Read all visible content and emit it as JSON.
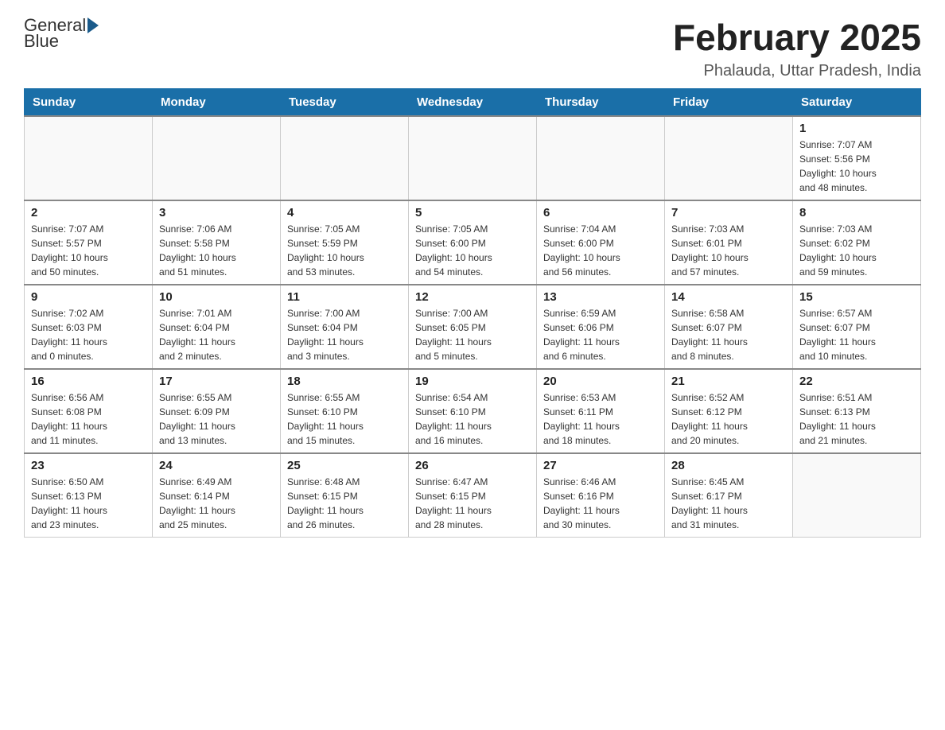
{
  "header": {
    "logo_general": "General",
    "logo_blue": "Blue",
    "month_title": "February 2025",
    "location": "Phalauda, Uttar Pradesh, India"
  },
  "days_of_week": [
    "Sunday",
    "Monday",
    "Tuesday",
    "Wednesday",
    "Thursday",
    "Friday",
    "Saturday"
  ],
  "weeks": [
    [
      {
        "day": "",
        "info": ""
      },
      {
        "day": "",
        "info": ""
      },
      {
        "day": "",
        "info": ""
      },
      {
        "day": "",
        "info": ""
      },
      {
        "day": "",
        "info": ""
      },
      {
        "day": "",
        "info": ""
      },
      {
        "day": "1",
        "info": "Sunrise: 7:07 AM\nSunset: 5:56 PM\nDaylight: 10 hours\nand 48 minutes."
      }
    ],
    [
      {
        "day": "2",
        "info": "Sunrise: 7:07 AM\nSunset: 5:57 PM\nDaylight: 10 hours\nand 50 minutes."
      },
      {
        "day": "3",
        "info": "Sunrise: 7:06 AM\nSunset: 5:58 PM\nDaylight: 10 hours\nand 51 minutes."
      },
      {
        "day": "4",
        "info": "Sunrise: 7:05 AM\nSunset: 5:59 PM\nDaylight: 10 hours\nand 53 minutes."
      },
      {
        "day": "5",
        "info": "Sunrise: 7:05 AM\nSunset: 6:00 PM\nDaylight: 10 hours\nand 54 minutes."
      },
      {
        "day": "6",
        "info": "Sunrise: 7:04 AM\nSunset: 6:00 PM\nDaylight: 10 hours\nand 56 minutes."
      },
      {
        "day": "7",
        "info": "Sunrise: 7:03 AM\nSunset: 6:01 PM\nDaylight: 10 hours\nand 57 minutes."
      },
      {
        "day": "8",
        "info": "Sunrise: 7:03 AM\nSunset: 6:02 PM\nDaylight: 10 hours\nand 59 minutes."
      }
    ],
    [
      {
        "day": "9",
        "info": "Sunrise: 7:02 AM\nSunset: 6:03 PM\nDaylight: 11 hours\nand 0 minutes."
      },
      {
        "day": "10",
        "info": "Sunrise: 7:01 AM\nSunset: 6:04 PM\nDaylight: 11 hours\nand 2 minutes."
      },
      {
        "day": "11",
        "info": "Sunrise: 7:00 AM\nSunset: 6:04 PM\nDaylight: 11 hours\nand 3 minutes."
      },
      {
        "day": "12",
        "info": "Sunrise: 7:00 AM\nSunset: 6:05 PM\nDaylight: 11 hours\nand 5 minutes."
      },
      {
        "day": "13",
        "info": "Sunrise: 6:59 AM\nSunset: 6:06 PM\nDaylight: 11 hours\nand 6 minutes."
      },
      {
        "day": "14",
        "info": "Sunrise: 6:58 AM\nSunset: 6:07 PM\nDaylight: 11 hours\nand 8 minutes."
      },
      {
        "day": "15",
        "info": "Sunrise: 6:57 AM\nSunset: 6:07 PM\nDaylight: 11 hours\nand 10 minutes."
      }
    ],
    [
      {
        "day": "16",
        "info": "Sunrise: 6:56 AM\nSunset: 6:08 PM\nDaylight: 11 hours\nand 11 minutes."
      },
      {
        "day": "17",
        "info": "Sunrise: 6:55 AM\nSunset: 6:09 PM\nDaylight: 11 hours\nand 13 minutes."
      },
      {
        "day": "18",
        "info": "Sunrise: 6:55 AM\nSunset: 6:10 PM\nDaylight: 11 hours\nand 15 minutes."
      },
      {
        "day": "19",
        "info": "Sunrise: 6:54 AM\nSunset: 6:10 PM\nDaylight: 11 hours\nand 16 minutes."
      },
      {
        "day": "20",
        "info": "Sunrise: 6:53 AM\nSunset: 6:11 PM\nDaylight: 11 hours\nand 18 minutes."
      },
      {
        "day": "21",
        "info": "Sunrise: 6:52 AM\nSunset: 6:12 PM\nDaylight: 11 hours\nand 20 minutes."
      },
      {
        "day": "22",
        "info": "Sunrise: 6:51 AM\nSunset: 6:13 PM\nDaylight: 11 hours\nand 21 minutes."
      }
    ],
    [
      {
        "day": "23",
        "info": "Sunrise: 6:50 AM\nSunset: 6:13 PM\nDaylight: 11 hours\nand 23 minutes."
      },
      {
        "day": "24",
        "info": "Sunrise: 6:49 AM\nSunset: 6:14 PM\nDaylight: 11 hours\nand 25 minutes."
      },
      {
        "day": "25",
        "info": "Sunrise: 6:48 AM\nSunset: 6:15 PM\nDaylight: 11 hours\nand 26 minutes."
      },
      {
        "day": "26",
        "info": "Sunrise: 6:47 AM\nSunset: 6:15 PM\nDaylight: 11 hours\nand 28 minutes."
      },
      {
        "day": "27",
        "info": "Sunrise: 6:46 AM\nSunset: 6:16 PM\nDaylight: 11 hours\nand 30 minutes."
      },
      {
        "day": "28",
        "info": "Sunrise: 6:45 AM\nSunset: 6:17 PM\nDaylight: 11 hours\nand 31 minutes."
      },
      {
        "day": "",
        "info": ""
      }
    ]
  ]
}
